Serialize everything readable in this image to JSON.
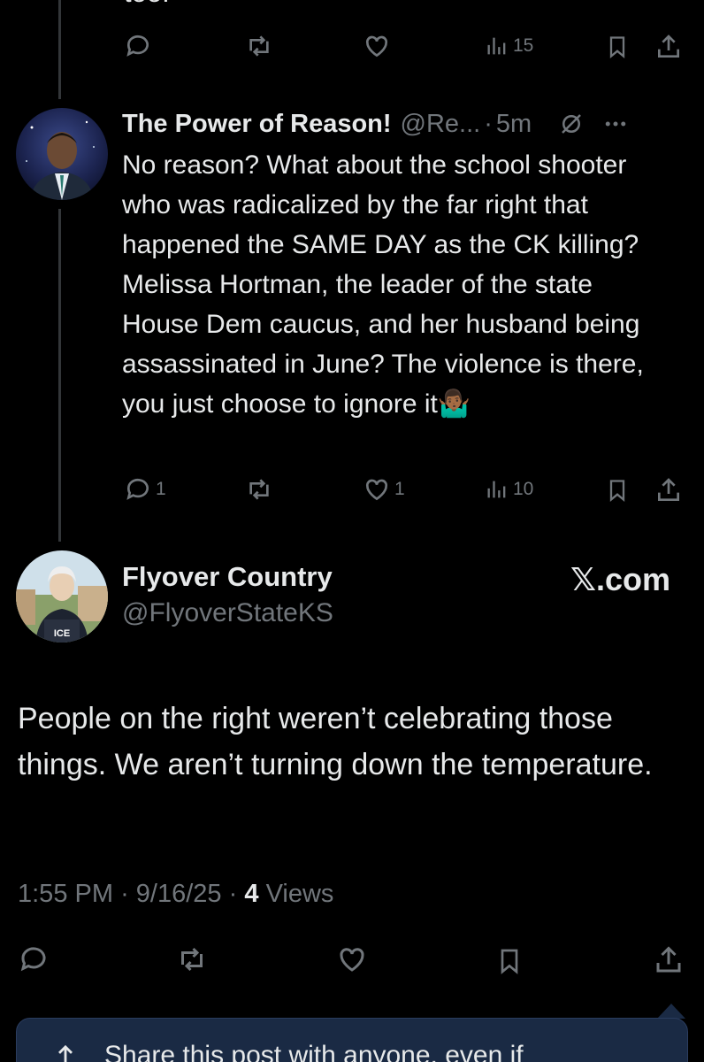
{
  "top_partial_text": "too.",
  "top_actions": {
    "views": "15"
  },
  "reply": {
    "name": "The Power of Reason!",
    "handle": "@Re...",
    "separator": "·",
    "time": "5m",
    "text": "No reason? What about the school shooter who was radicalized by the far right that happened the SAME DAY as the CK killing? Melissa Hortman, the leader of the state House Dem caucus, and her husband being assassinated in June? The violence is there, you just choose to ignore it🤷🏾‍♂️",
    "replies": "1",
    "likes": "1",
    "views": "10"
  },
  "main_post": {
    "name": "Flyover Country",
    "handle": "@FlyoverStateKS",
    "watermark": "𝕏.com",
    "avatar_badge": "ICE",
    "text": "People on the right weren’t celebrating those things. We aren’t turning down the temperature.",
    "time": "1:55 PM",
    "date": "9/16/25",
    "views_count": "4",
    "views_label": "Views",
    "separator": "·"
  },
  "share_prompt": {
    "text": "Share this post with anyone, even if"
  },
  "colors": {
    "background": "#000000",
    "text": "#e7e9ea",
    "muted": "#71767b",
    "share_bg": "#1a2a44"
  }
}
